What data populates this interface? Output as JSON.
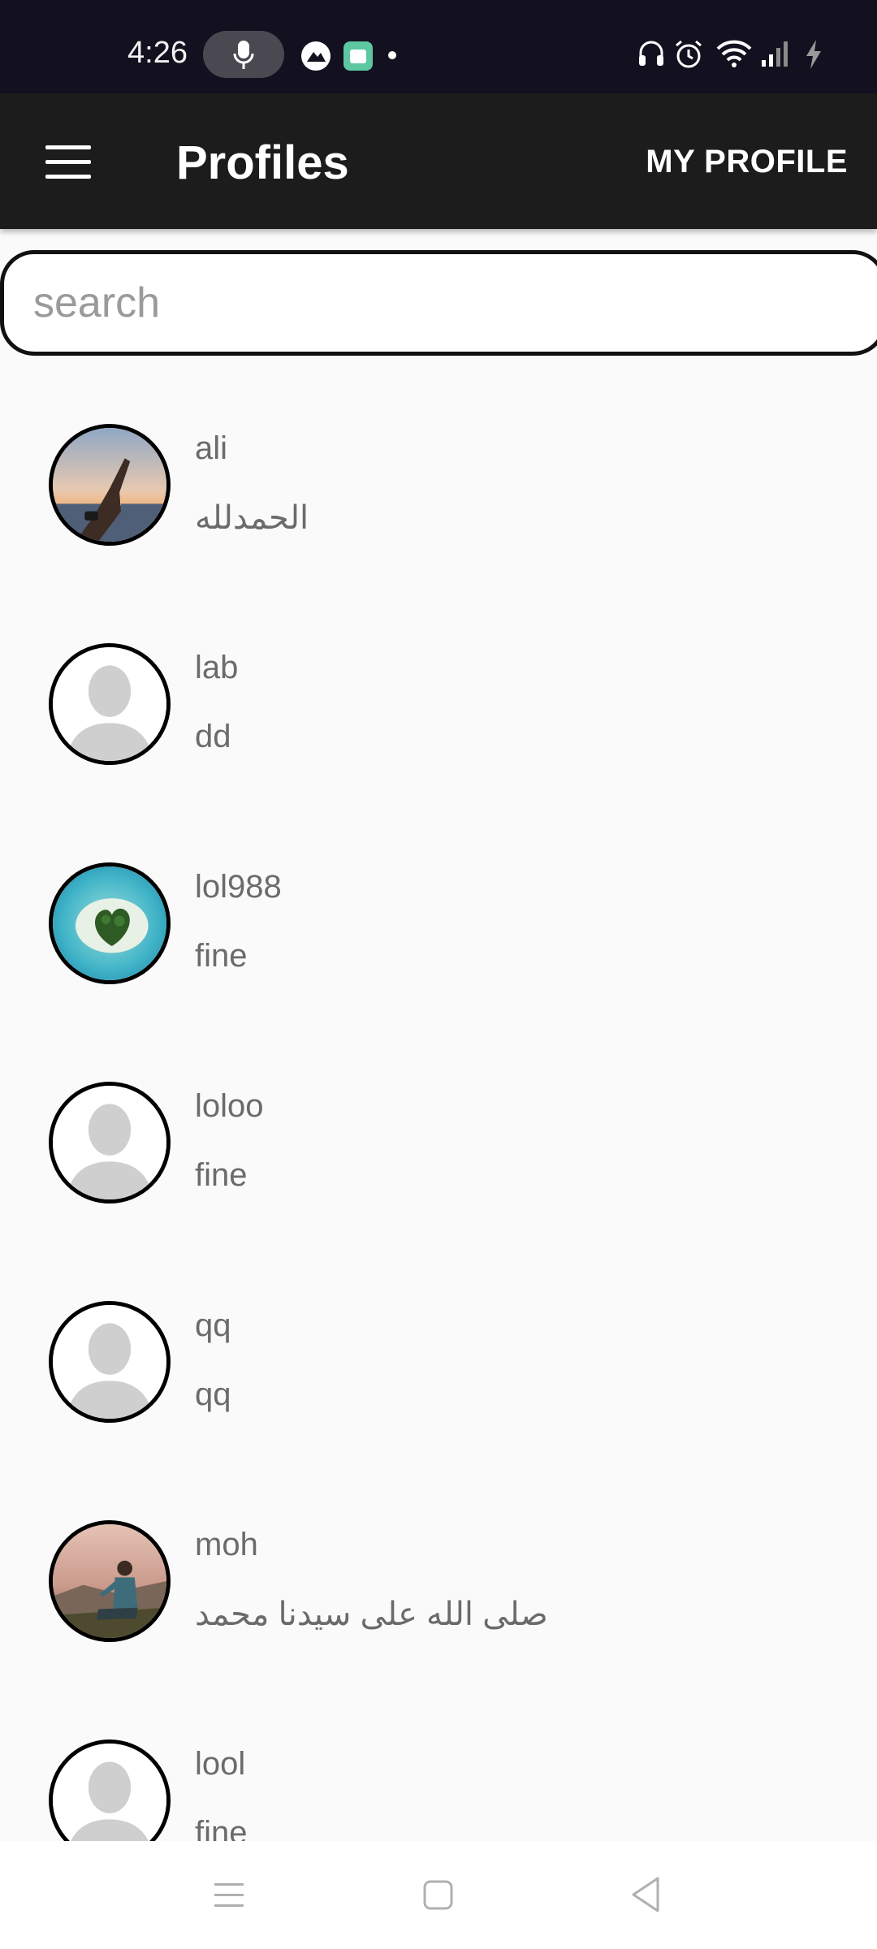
{
  "status_bar": {
    "time": "4:26",
    "icons": [
      "mic-icon",
      "app-notification-icon",
      "gallery-notification-icon",
      "dot-icon",
      "headset-icon",
      "alarm-icon",
      "wifi-icon",
      "signal-icon",
      "charging-icon"
    ]
  },
  "app_bar": {
    "title": "Profiles",
    "menu_icon": "hamburger-menu-icon",
    "action_label": "MY PROFILE"
  },
  "search": {
    "placeholder": "search",
    "value": ""
  },
  "profiles": [
    {
      "name": "ali",
      "status": "الحمدلله",
      "avatar": "photo-hand-sunset"
    },
    {
      "name": "lab",
      "status": "dd",
      "avatar": "default-person"
    },
    {
      "name": "lol988",
      "status": "fine",
      "avatar": "photo-heart-island"
    },
    {
      "name": "loloo",
      "status": "fine",
      "avatar": "default-person"
    },
    {
      "name": "qq",
      "status": "qq",
      "avatar": "default-person"
    },
    {
      "name": "moh",
      "status": "صلى الله على سيدنا محمد",
      "avatar": "photo-man-sitting"
    },
    {
      "name": "lool",
      "status": "fine",
      "avatar": "default-person"
    }
  ],
  "nav_bar": {
    "icons": [
      "recents-icon",
      "home-icon",
      "back-icon"
    ]
  },
  "colors": {
    "status_bar_bg": "#13111f",
    "app_bar_bg": "#1d1c1c",
    "page_bg": "#fafafa",
    "text_secondary": "#6b6b6b"
  }
}
